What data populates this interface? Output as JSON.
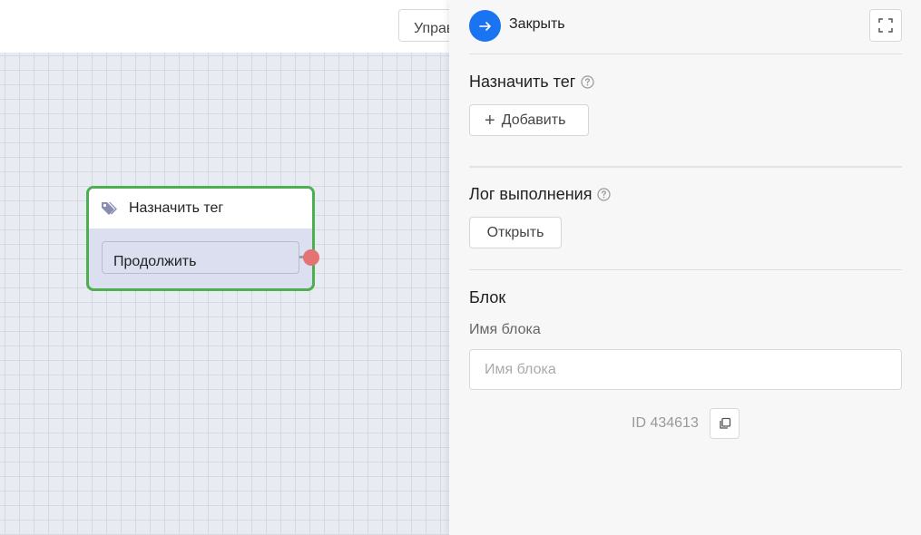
{
  "topbar": {
    "button_label": "Управление"
  },
  "canvas": {
    "node": {
      "title": "Назначить тег",
      "icon": "tag-icon",
      "continue_label": "Продолжить",
      "border_color": "#4caf50",
      "connector_color": "#e57373"
    }
  },
  "panel": {
    "close_label": "Закрыть",
    "close_icon": "arrow-right-icon",
    "expand_icon": "fullscreen-icon",
    "accent_color": "#1a73f0",
    "assign_tag": {
      "title": "Назначить тег",
      "add_label": "Добавить"
    },
    "execution_log": {
      "title": "Лог выполнения",
      "open_label": "Открыть"
    },
    "block": {
      "title": "Блок",
      "name_label": "Имя блока",
      "name_placeholder": "Имя блока",
      "name_value": "",
      "id_text": "ID 434613"
    }
  }
}
